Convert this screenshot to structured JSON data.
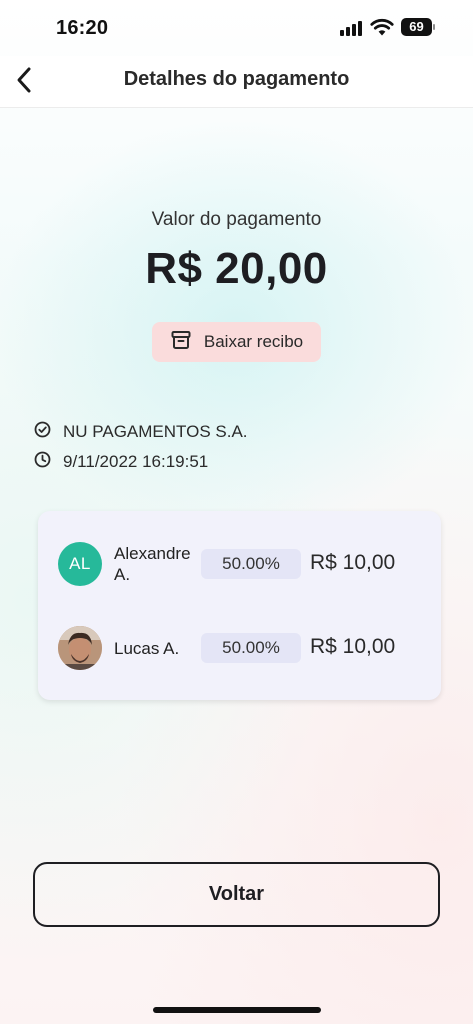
{
  "status_bar": {
    "time": "16:20",
    "battery_level": "69",
    "icons": [
      "cellular-signal-icon",
      "wifi-icon",
      "battery-icon"
    ]
  },
  "nav": {
    "title": "Detalhes do pagamento",
    "back_icon": "chevron-left-icon"
  },
  "payment": {
    "amount_label": "Valor do pagamento",
    "amount": "R$ 20,00",
    "receipt_button_label": "Baixar recibo",
    "receipt_icon": "archive-box-icon",
    "payee": "NU PAGAMENTOS S.A.",
    "payee_icon": "check-circle-icon",
    "datetime": "9/11/2022 16:19:51",
    "datetime_icon": "clock-icon"
  },
  "split": {
    "participants": [
      {
        "initials": "AL",
        "name": "Alexandre A.",
        "percent": "50.00%",
        "amount": "R$ 10,00",
        "avatar_color": "#26b99a"
      },
      {
        "name": "Lucas A.",
        "percent": "50.00%",
        "amount": "R$ 10,00",
        "avatar": "user-photo"
      }
    ]
  },
  "actions": {
    "back_label": "Voltar"
  },
  "colors": {
    "receipt_button_bg": "#fadcdc",
    "card_bg": "#f2f2fb",
    "percent_pill_bg": "#e4e5f6",
    "avatar_green": "#26b99a"
  }
}
